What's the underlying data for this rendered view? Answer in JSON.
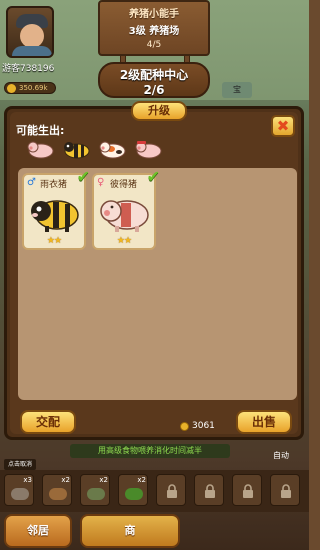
{
  "top": {
    "player_name": "游客738196",
    "coins_pill": "350.69k",
    "sign": {
      "title": "养猪小能手",
      "level_farm": "3级 养猪场",
      "progress": "4/5"
    },
    "plaque": {
      "title": "2级配种中心",
      "progress": "2/6"
    },
    "side_label": "宝"
  },
  "panel": {
    "upgrade_tab": "升级",
    "may_born_label": "可能生出:",
    "close_icon": "close-x-icon",
    "offspring_icons": [
      "pink-pig-icon",
      "bee-pig-icon",
      "spotted-pig-icon",
      "pink-bandana-pig-icon"
    ],
    "cards": [
      {
        "gender": "♂",
        "gender_type": "male",
        "name": "雨衣猪",
        "stars": "★★",
        "selected": true,
        "pig": "bee"
      },
      {
        "gender": "♀",
        "gender_type": "female",
        "name": "彼得猪",
        "stars": "★★",
        "selected": true,
        "pig": "peter"
      }
    ],
    "breed_button": "交配",
    "coin_total": "3061",
    "sell_button": "出售"
  },
  "bottom": {
    "feed_tip": "用高级食物喂养消化时间减半",
    "auto_eat": "自动",
    "tap_cancel": "点击取消",
    "food_slots": [
      {
        "qty": "x3",
        "type": "food",
        "color": "#8a7a6a"
      },
      {
        "qty": "x2",
        "type": "food",
        "color": "#9a6a3a"
      },
      {
        "qty": "x2",
        "type": "food",
        "color": "#6a7a4a"
      },
      {
        "qty": "x2",
        "type": "food",
        "color": "#4a8a2a"
      },
      {
        "type": "locked"
      },
      {
        "type": "locked"
      },
      {
        "type": "locked"
      },
      {
        "type": "locked"
      },
      {
        "type": "locked"
      }
    ],
    "nav_left": "邻居",
    "nav_mid": "商"
  },
  "colors": {
    "panel_bg": "#5a381c",
    "content_bg": "#b79572",
    "gold_button": "#f2c04a",
    "check_green": "#6cc22a"
  }
}
